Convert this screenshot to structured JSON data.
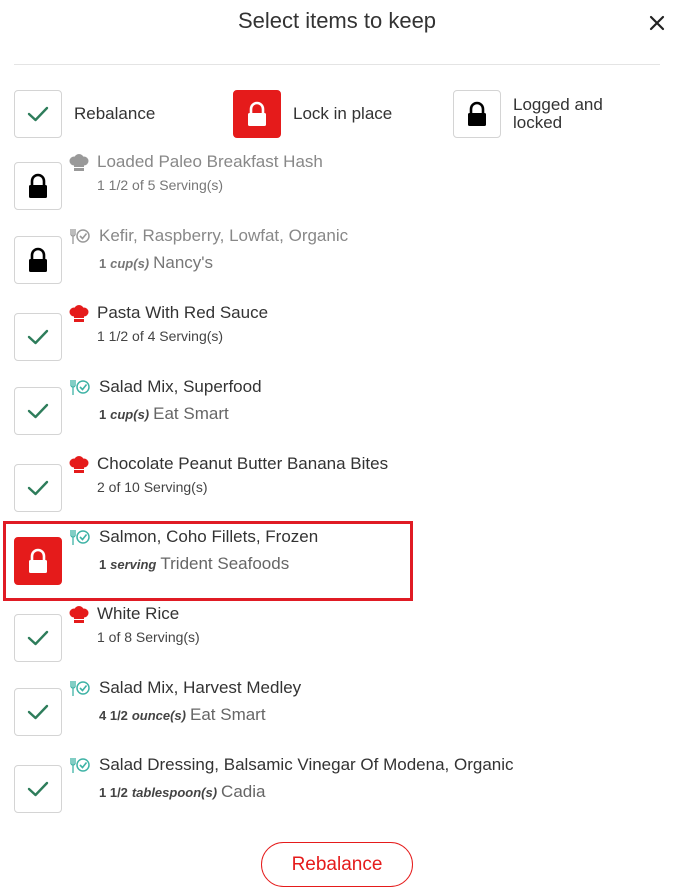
{
  "header": {
    "title": "Select items to keep"
  },
  "legend": {
    "rebalance": "Rebalance",
    "lock": "Lock in place",
    "logged_line1": "Logged and",
    "logged_line2": "locked"
  },
  "items": [
    {
      "state": "logged",
      "type": "recipe",
      "dim": true,
      "name": "Loaded Paleo Breakfast Hash",
      "qty": "1 1/2 of 5 Serving(s)",
      "unit": "",
      "brand": ""
    },
    {
      "state": "logged",
      "type": "food",
      "dim": true,
      "name": "Kefir, Raspberry, Lowfat, Organic",
      "qty": "1",
      "unit": "cup(s)",
      "brand": "Nancy's"
    },
    {
      "state": "rebalance",
      "type": "recipe",
      "dim": false,
      "name": "Pasta With Red Sauce",
      "qty": "1 1/2 of 4 Serving(s)",
      "unit": "",
      "brand": ""
    },
    {
      "state": "rebalance",
      "type": "food",
      "dim": false,
      "name": "Salad Mix, Superfood",
      "qty": "1",
      "unit": "cup(s)",
      "brand": "Eat Smart"
    },
    {
      "state": "rebalance",
      "type": "recipe",
      "dim": false,
      "name": "Chocolate Peanut Butter Banana Bites",
      "qty": "2 of 10 Serving(s)",
      "unit": "",
      "brand": ""
    },
    {
      "state": "lock",
      "type": "food",
      "dim": false,
      "name": "Salmon, Coho Fillets, Frozen",
      "qty": "1",
      "unit": "serving",
      "brand": "Trident Seafoods"
    },
    {
      "state": "rebalance",
      "type": "recipe",
      "dim": false,
      "name": "White Rice",
      "qty": "1 of 8 Serving(s)",
      "unit": "",
      "brand": ""
    },
    {
      "state": "rebalance",
      "type": "food",
      "dim": false,
      "name": "Salad Mix, Harvest Medley",
      "qty": "4 1/2",
      "unit": "ounce(s)",
      "brand": "Eat Smart"
    },
    {
      "state": "rebalance",
      "type": "food",
      "dim": false,
      "name": "Salad Dressing, Balsamic Vinegar Of Modena, Organic",
      "qty": "1 1/2",
      "unit": "tablespoon(s)",
      "brand": "Cadia"
    }
  ],
  "footer": {
    "button_label": "Rebalance"
  },
  "colors": {
    "red": "#e51b1b",
    "green": "#2e7d5b",
    "teal": "#3fb3a6",
    "grey": "#999999"
  }
}
